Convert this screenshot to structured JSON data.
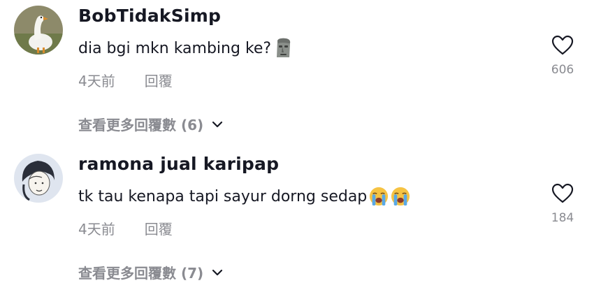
{
  "comments": [
    {
      "username": "BobTidakSimp",
      "text": "dia bgi mkn kambing ke?",
      "emoji": [
        "moai-emoji"
      ],
      "time": "4天前",
      "reply_label": "回覆",
      "likes": "606",
      "more_replies": "查看更多回覆數 (6)"
    },
    {
      "username": "ramona jual karipap",
      "text": "tk tau kenapa tapi sayur dorng sedap",
      "emoji": [
        "loudly-crying-face-emoji",
        "loudly-crying-face-emoji"
      ],
      "time": "4天前",
      "reply_label": "回覆",
      "likes": "184",
      "more_replies": "查看更多回覆數 (7)"
    }
  ],
  "icons": {
    "like": "heart-outline-icon",
    "expand": "chevron-down-icon"
  },
  "colors": {
    "primary_text": "#161823",
    "secondary_text": "#8a8b91"
  }
}
